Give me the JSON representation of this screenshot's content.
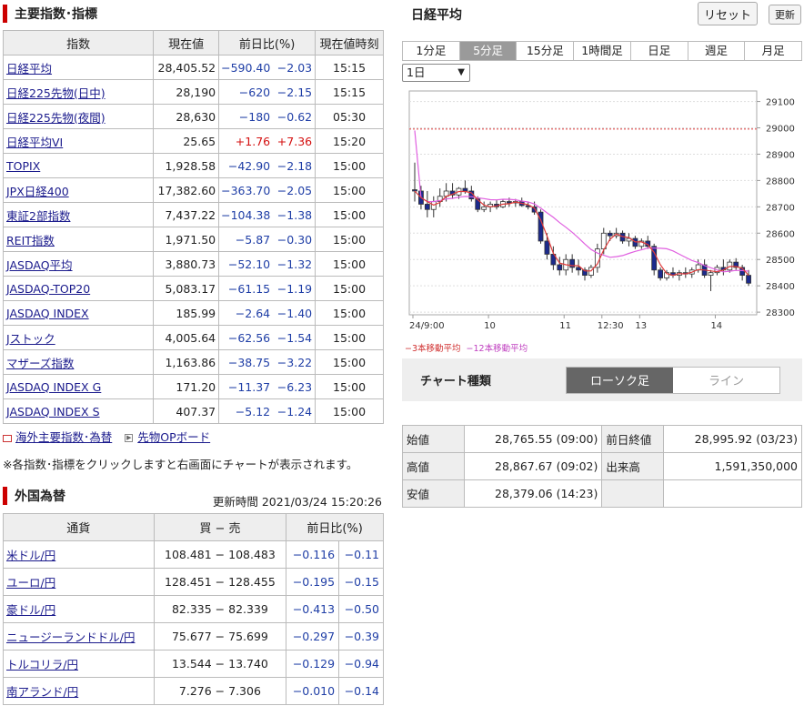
{
  "indices_section": {
    "title": "主要指数･指標",
    "headers": [
      "指数",
      "現在値",
      "前日比(%)",
      "現在値時刻"
    ],
    "rows": [
      {
        "name": "日経平均",
        "value": "28,405.52",
        "chg": "−590.40",
        "pct": "−2.03",
        "time": "15:15",
        "dir": "neg"
      },
      {
        "name": "日経225先物(日中)",
        "value": "28,190",
        "chg": "−620",
        "pct": "−2.15",
        "time": "15:15",
        "dir": "neg"
      },
      {
        "name": "日経225先物(夜間)",
        "value": "28,630",
        "chg": "−180",
        "pct": "−0.62",
        "time": "05:30",
        "dir": "neg"
      },
      {
        "name": "日経平均VI",
        "value": "25.65",
        "chg": "+1.76",
        "pct": "+7.36",
        "time": "15:20",
        "dir": "pos"
      },
      {
        "name": "TOPIX",
        "value": "1,928.58",
        "chg": "−42.90",
        "pct": "−2.18",
        "time": "15:00",
        "dir": "neg"
      },
      {
        "name": "JPX日経400",
        "value": "17,382.60",
        "chg": "−363.70",
        "pct": "−2.05",
        "time": "15:00",
        "dir": "neg"
      },
      {
        "name": "東証2部指数",
        "value": "7,437.22",
        "chg": "−104.38",
        "pct": "−1.38",
        "time": "15:00",
        "dir": "neg"
      },
      {
        "name": "REIT指数",
        "value": "1,971.50",
        "chg": "−5.87",
        "pct": "−0.30",
        "time": "15:00",
        "dir": "neg"
      },
      {
        "name": "JASDAQ平均",
        "value": "3,880.73",
        "chg": "−52.10",
        "pct": "−1.32",
        "time": "15:00",
        "dir": "neg"
      },
      {
        "name": "JASDAQ-TOP20",
        "value": "5,083.17",
        "chg": "−61.15",
        "pct": "−1.19",
        "time": "15:00",
        "dir": "neg"
      },
      {
        "name": "JASDAQ INDEX",
        "value": "185.99",
        "chg": "−2.64",
        "pct": "−1.40",
        "time": "15:00",
        "dir": "neg"
      },
      {
        "name": "Jストック",
        "value": "4,005.64",
        "chg": "−62.56",
        "pct": "−1.54",
        "time": "15:00",
        "dir": "neg"
      },
      {
        "name": "マザーズ指数",
        "value": "1,163.86",
        "chg": "−38.75",
        "pct": "−3.22",
        "time": "15:00",
        "dir": "neg"
      },
      {
        "name": "JASDAQ INDEX G",
        "value": "171.20",
        "chg": "−11.37",
        "pct": "−6.23",
        "time": "15:00",
        "dir": "neg"
      },
      {
        "name": "JASDAQ INDEX S",
        "value": "407.37",
        "chg": "−5.12",
        "pct": "−1.24",
        "time": "15:00",
        "dir": "neg"
      }
    ],
    "link_overseas": "海外主要指数･為替",
    "link_options": "先物OPボード",
    "note": "※各指数･指標をクリックしますと右画面にチャートが表示されます。"
  },
  "fx_section": {
    "title": "外国為替",
    "updated": "更新時間 2021/03/24 15:20:26",
    "headers": [
      "通貨",
      "買 − 売",
      "前日比(%)"
    ],
    "rows": [
      {
        "name": "米ドル/円",
        "bidask": "108.481 − 108.483",
        "chg": "−0.116",
        "pct": "−0.11"
      },
      {
        "name": "ユーロ/円",
        "bidask": "128.451 − 128.455",
        "chg": "−0.195",
        "pct": "−0.15"
      },
      {
        "name": "豪ドル/円",
        "bidask": "82.335 − 82.339",
        "chg": "−0.413",
        "pct": "−0.50"
      },
      {
        "name": "ニュージーランドドル/円",
        "bidask": "75.677 − 75.699",
        "chg": "−0.297",
        "pct": "−0.39"
      },
      {
        "name": "トルコリラ/円",
        "bidask": "13.544 − 13.740",
        "chg": "−0.129",
        "pct": "−0.94"
      },
      {
        "name": "南アランド/円",
        "bidask": "7.276 − 7.306",
        "chg": "−0.010",
        "pct": "−0.14"
      }
    ]
  },
  "chart_panel": {
    "title": "日経平均",
    "reset_label": "リセット",
    "refresh_label": "更新",
    "tabs": [
      "1分足",
      "5分足",
      "15分足",
      "1時間足",
      "日足",
      "週足",
      "月足"
    ],
    "active_tab": 1,
    "period_select": "1日",
    "legend_ma3": "−3本移動平均",
    "legend_ma12": "−12本移動平均",
    "chart_type_label": "チャート種類",
    "type_candle": "ローソク足",
    "type_line": "ライン",
    "colors": {
      "up": "#ffffff",
      "down": "#1c2a8c",
      "ma3": "#e03a3a",
      "ma12": "#e060e0",
      "ref": "#e67a7a"
    }
  },
  "ohlc": {
    "open_label": "始値",
    "open": "28,765.55 (09:00)",
    "high_label": "高値",
    "high": "28,867.67 (09:02)",
    "low_label": "安値",
    "low": "28,379.06 (14:23)",
    "prevclose_label": "前日終値",
    "prevclose": "28,995.92 (03/23)",
    "volume_label": "出来高",
    "volume": "1,591,350,000"
  },
  "chart_data": {
    "type": "candlestick",
    "x_tick_labels": [
      "24/9:00",
      "10",
      "11",
      "12:30",
      "13",
      "14"
    ],
    "y_ticks": [
      28300,
      28400,
      28500,
      28600,
      28700,
      28800,
      28900,
      29000,
      29100
    ],
    "ylim": [
      28290,
      29140
    ],
    "reference_line": 28995.92,
    "candles": [
      [
        28765,
        28868,
        28720,
        28760
      ],
      [
        28760,
        28780,
        28690,
        28710
      ],
      [
        28710,
        28760,
        28660,
        28690
      ],
      [
        28690,
        28740,
        28660,
        28720
      ],
      [
        28720,
        28770,
        28700,
        28740
      ],
      [
        28740,
        28790,
        28720,
        28760
      ],
      [
        28760,
        28790,
        28730,
        28745
      ],
      [
        28745,
        28775,
        28730,
        28770
      ],
      [
        28770,
        28800,
        28750,
        28760
      ],
      [
        28760,
        28780,
        28720,
        28730
      ],
      [
        28730,
        28740,
        28680,
        28690
      ],
      [
        28690,
        28720,
        28680,
        28700
      ],
      [
        28700,
        28720,
        28680,
        28710
      ],
      [
        28710,
        28725,
        28690,
        28700
      ],
      [
        28700,
        28730,
        28695,
        28720
      ],
      [
        28720,
        28735,
        28700,
        28715
      ],
      [
        28715,
        28730,
        28700,
        28720
      ],
      [
        28720,
        28735,
        28700,
        28705
      ],
      [
        28705,
        28720,
        28690,
        28700
      ],
      [
        28700,
        28720,
        28670,
        28680
      ],
      [
        28680,
        28690,
        28560,
        28570
      ],
      [
        28570,
        28600,
        28500,
        28520
      ],
      [
        28520,
        28550,
        28460,
        28480
      ],
      [
        28480,
        28510,
        28440,
        28460
      ],
      [
        28460,
        28520,
        28440,
        28500
      ],
      [
        28500,
        28520,
        28450,
        28470
      ],
      [
        28470,
        28500,
        28440,
        28460
      ],
      [
        28460,
        28470,
        28420,
        28440
      ],
      [
        28440,
        28480,
        28430,
        28470
      ],
      [
        28470,
        28560,
        28450,
        28540
      ],
      [
        28540,
        28620,
        28520,
        28600
      ],
      [
        28600,
        28610,
        28570,
        28590
      ],
      [
        28590,
        28620,
        28580,
        28600
      ],
      [
        28600,
        28610,
        28560,
        28570
      ],
      [
        28570,
        28600,
        28550,
        28580
      ],
      [
        28580,
        28590,
        28540,
        28550
      ],
      [
        28550,
        28580,
        28540,
        28570
      ],
      [
        28570,
        28590,
        28540,
        28550
      ],
      [
        28550,
        28560,
        28440,
        28460
      ],
      [
        28460,
        28470,
        28420,
        28430
      ],
      [
        28430,
        28460,
        28420,
        28450
      ],
      [
        28450,
        28470,
        28430,
        28440
      ],
      [
        28440,
        28460,
        28420,
        28450
      ],
      [
        28450,
        28470,
        28430,
        28445
      ],
      [
        28445,
        28470,
        28430,
        28460
      ],
      [
        28460,
        28500,
        28450,
        28480
      ],
      [
        28480,
        28500,
        28430,
        28440
      ],
      [
        28440,
        28460,
        28380,
        28450
      ],
      [
        28450,
        28480,
        28440,
        28470
      ],
      [
        28470,
        28500,
        28440,
        28460
      ],
      [
        28460,
        28500,
        28450,
        28490
      ],
      [
        28490,
        28505,
        28460,
        28470
      ],
      [
        28470,
        28480,
        28420,
        28440
      ],
      [
        28440,
        28460,
        28400,
        28410
      ]
    ]
  }
}
